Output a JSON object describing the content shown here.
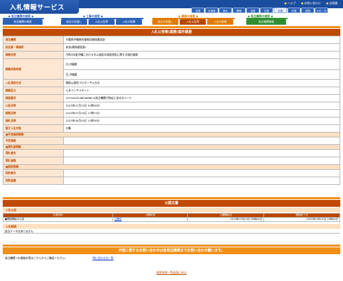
{
  "header": {
    "app_title": "入札情報サービス",
    "top_links": [
      "ヘルプ",
      "お問い合わせ",
      "全国履"
    ],
    "regions": [
      {
        "label": "全国",
        "selected": false
      },
      {
        "label": "北海道",
        "selected": false
      },
      {
        "label": "東北",
        "selected": false
      },
      {
        "label": "関東",
        "selected": false
      },
      {
        "label": "北陸",
        "selected": false
      },
      {
        "label": "中部",
        "selected": false
      },
      {
        "label": "近畿",
        "selected": true
      },
      {
        "label": "中国",
        "selected": false
      },
      {
        "label": "四国",
        "selected": false
      },
      {
        "label": "九州・沖",
        "selected": false
      }
    ],
    "nav_groups": [
      {
        "title": "◆ 発注機関の検索 ◆",
        "color": "#2c62b8",
        "tabs": [
          "発注機関の検索"
        ]
      },
      {
        "title": "◆ 工事の検索 ◆",
        "color": "#2c62b8",
        "tabs": [
          "発注の見通し",
          "入札公告等",
          "入札の結果"
        ]
      },
      {
        "title": "◆ 業務の検索 ◆",
        "color": "#e07a00",
        "tabs": [
          "発注の見通し",
          "入札公告等",
          "入札の結果"
        ]
      },
      {
        "title": "◆ 発注機関の検索 ◆",
        "color": "#2f8f2f",
        "tabs": [
          "発注機関情報"
        ]
      }
    ]
  },
  "detail": {
    "title": "入札公告等(業務)案件概要",
    "rows": [
      {
        "label": "発注機関",
        "value": "内閣府沖縄総合事務局開発建設部"
      },
      {
        "label": "担当部・事務所",
        "value": "本部(開発建設部)"
      },
      {
        "label": "業務名称",
        "value": "令和5年度沖縄におけるダム施設の高度運用に関する検討業務"
      },
      {
        "label": "業務対象地域",
        "value": "白:沖縄県"
      },
      {
        "label": "",
        "value": "至:沖縄県"
      },
      {
        "label": "入札契約方式",
        "value": "簡易公募型プロポーザル方式"
      },
      {
        "label": "業務区分",
        "value": "土木コンサルタント"
      },
      {
        "label": "調達番号",
        "value": "2023000238636666       ※発注機関が独自に定めるコード"
      },
      {
        "label": "公告日時",
        "value": "2023年07月12日 00時00分"
      },
      {
        "label": "期限日時",
        "value": "2023年07月19日 17時15分"
      },
      {
        "label": "開札日時",
        "value": "2023年09月05日 11時00分"
      },
      {
        "label": "電子入札対象",
        "value": "対象"
      }
    ],
    "sections": [
      {
        "heading": "■予定価格情報",
        "rows": [
          "予定価格"
        ]
      },
      {
        "heading": "■落札者情報",
        "rows": [
          "落札者名",
          "落札価格"
        ]
      },
      {
        "heading": "■契約情報",
        "rows": [
          "契約者名",
          "契約金額"
        ]
      }
    ]
  },
  "public_docs": {
    "title": "公開文書",
    "section": "入札公告",
    "columns": [
      "文書名称",
      "公開状況",
      "公開開始日",
      "閲覧終了日"
    ],
    "row": {
      "name": "●閲覧開始の公告",
      "status": "公開中",
      "start": "2023年07月12日 00時00分",
      "end": "2023年09月21日 23時00分"
    },
    "section2": "入札経過",
    "no_data": "該当データはありません"
  },
  "contact": {
    "title": "内容に関するお問い合わせは各発注機関までお問い合わせ願います。",
    "text": "発注機関への連絡先等はこちらからご確認ください。",
    "link": "問い合わせ先一覧"
  },
  "footer": {
    "back": "検索結果一覧画面に戻る"
  }
}
